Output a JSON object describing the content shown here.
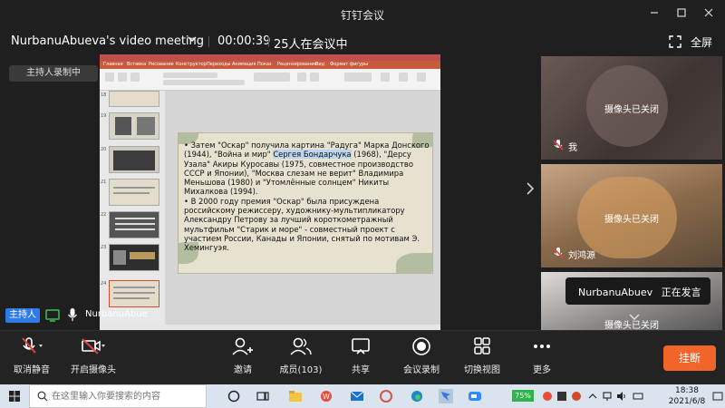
{
  "titlebar": {
    "app_title": "钉钉会议"
  },
  "meeting": {
    "title": "NurbanuAbueva's video meeting",
    "timer": "00:00:39",
    "participants_text": "25人在会议中",
    "fullscreen_label": "全屏",
    "recording_badge": "主持人录制中"
  },
  "slide": {
    "bullet1_pre": "• Затем \"Оскар\" получила картина \"Радуга\" Марка Донского (1944), \"Война и мир\" ",
    "bullet1_hl": "Сергея Бондарчука",
    "bullet1_post": " (1968), \"Дерсу Узала\" Акиры Куросавы (1975, совместное производство СССР и Японии), \"Москва слезам не верит\" Владимира Меньшова (1980) и \"Утомлённые солнцем\" Никиты Михалкова (1994).",
    "bullet2": "• В 2000 году премия \"Оскар\" была присуждена российскому режиссеру, художнику-мультипликатору Александру Петрову за лучший короткометражный мультфильм \"Старик и море\" - совместный проект с участием России, Канады и Японии, снятый по мотивам Э. Хемингуэя."
  },
  "ppt": {
    "tabs": [
      "Главная",
      "Вставка",
      "Рисование",
      "Конструктор",
      "Переходы",
      "Анимация",
      "Показ",
      "Рецензирование",
      "Вид",
      "Формат фигуры"
    ],
    "thumb_numbers": [
      "18",
      "19",
      "20",
      "21",
      "22",
      "23",
      "24"
    ]
  },
  "tiles": [
    {
      "cam_off": "摄像头已关闭",
      "name": "我"
    },
    {
      "cam_off": "摄像头已关闭",
      "name": "刘鸿源"
    },
    {
      "cam_off": "摄像头已关闭"
    }
  ],
  "speaker": {
    "name": "NurbanuAbuev",
    "status": "正在发言"
  },
  "self": {
    "host_badge": "主持人",
    "name": "NurbanuAbue"
  },
  "toolbar": {
    "unmute": "取消静音",
    "camera": "开启摄像头",
    "invite": "邀请",
    "members": "成员(103)",
    "share": "共享",
    "record": "会议录制",
    "switch_view": "切换视图",
    "more": "更多",
    "end": "挂断"
  },
  "taskbar": {
    "search_placeholder": "在这里输入你要搜索的内容",
    "battery": "75%",
    "time": "18:38",
    "date": "2021/6/8"
  },
  "colors": {
    "accent": "#2e7ae6",
    "end": "#f2652a",
    "mic_off": "#e5403a"
  }
}
